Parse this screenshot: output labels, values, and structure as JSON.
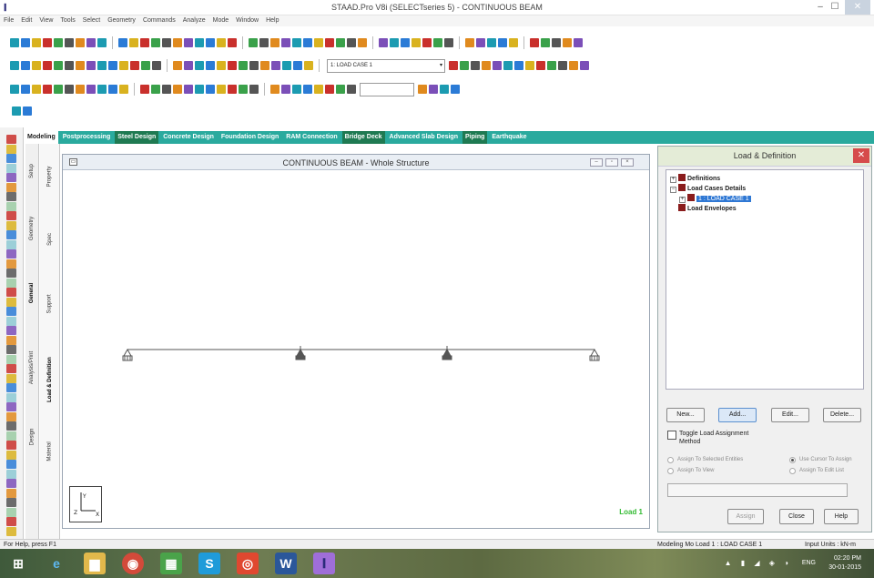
{
  "window": {
    "title": "STAAD.Pro V8i (SELECTseries 5) - CONTINUOUS BEAM",
    "app_icon": "staad-logo-icon",
    "minimize_glyph": "–",
    "maximize_glyph": "☐",
    "close_glyph": "✕"
  },
  "menu": [
    "File",
    "Edit",
    "View",
    "Tools",
    "Select",
    "Geometry",
    "Commands",
    "Analyze",
    "Mode",
    "Window",
    "Help"
  ],
  "toolbar": {
    "load_case_combo": "1: LOAD CASE 1"
  },
  "ribbon_tabs": [
    "Modeling",
    "Postprocessing",
    "Steel Design",
    "Concrete Design",
    "Foundation Design",
    "RAM Connection",
    "Bridge Deck",
    "Advanced Slab Design",
    "Piping",
    "Earthquake"
  ],
  "side_tabs_outer": [
    "Setup",
    "Geometry",
    "General",
    "Analysis/Print",
    "Design"
  ],
  "side_tabs_inner": [
    "Property",
    "Spec",
    "Support",
    "Load & Definition",
    "Material"
  ],
  "viewport": {
    "title": "CONTINUOUS BEAM - Whole Structure",
    "load_label": "Load 1",
    "beam_supports": 4
  },
  "load_panel": {
    "title": "Load & Definition",
    "tree": [
      {
        "label": "Definitions",
        "expand": "+"
      },
      {
        "label": "Load Cases Details",
        "expand": "−"
      },
      {
        "label": "1 : LOAD CASE 1",
        "expand": "",
        "selected": true
      },
      {
        "label": "Load Envelopes",
        "expand": "+"
      }
    ],
    "buttons": [
      "New...",
      "Add...",
      "Edit...",
      "Delete..."
    ],
    "toggle_load": "Toggle Load Assignment Method",
    "radio_assign_selected": "Assign To Selected Entities",
    "radio_assign_view": "Assign To View",
    "radio_use_cursor": "Use Cursor To Assign",
    "radio_edit_list": "Assign To Edit List",
    "assign_button": "Assign",
    "close_button": "Close",
    "help_button": "Help"
  },
  "status": {
    "help_text": "For Help, press F1",
    "mode_text": "Modeling Mo Load 1 : LOAD CASE 1",
    "units_text": "Input Units : kN-m"
  },
  "taskbar": {
    "lang": "ENG",
    "time": "02:20 PM",
    "date": "30-01-2015"
  },
  "colors": {
    "ribbon": "#2aaa9e",
    "ribbon_highlight": "#1f7a52",
    "load_label": "#33bb33",
    "tree_selected": "#2f78d4",
    "panel_close": "#d64b4b"
  }
}
